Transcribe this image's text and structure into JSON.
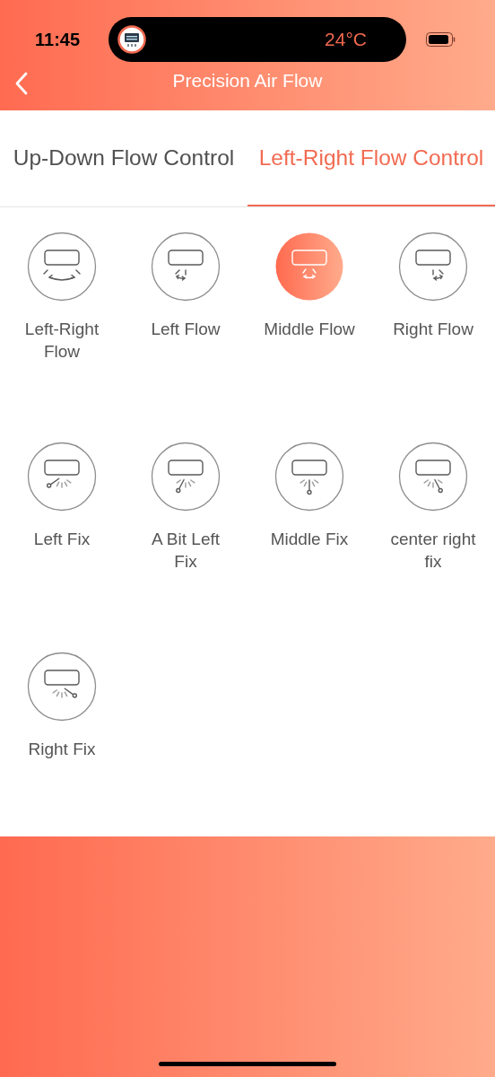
{
  "status_bar": {
    "time": "11:45",
    "temperature": "24°C"
  },
  "header": {
    "title": "Precision Air Flow"
  },
  "tabs": [
    {
      "label": "Up-Down Flow Control",
      "selected": false
    },
    {
      "label": "Left-Right Flow Control",
      "selected": true
    }
  ],
  "modes": [
    {
      "label": "Left-Right Flow",
      "kind": "swing-both",
      "selected": false
    },
    {
      "label": "Left Flow",
      "kind": "swing-left",
      "selected": false
    },
    {
      "label": "Middle Flow",
      "kind": "swing-middle",
      "selected": true
    },
    {
      "label": "Right Flow",
      "kind": "swing-right",
      "selected": false
    },
    {
      "label": "Left Fix",
      "kind": "fix-left",
      "selected": false
    },
    {
      "label": "A Bit Left Fix",
      "kind": "fix-slight-left",
      "selected": false
    },
    {
      "label": "Middle Fix",
      "kind": "fix-middle",
      "selected": false
    },
    {
      "label": "center right fix",
      "kind": "fix-slight-right",
      "selected": false
    },
    {
      "label": "Right Fix",
      "kind": "fix-right",
      "selected": false
    }
  ]
}
